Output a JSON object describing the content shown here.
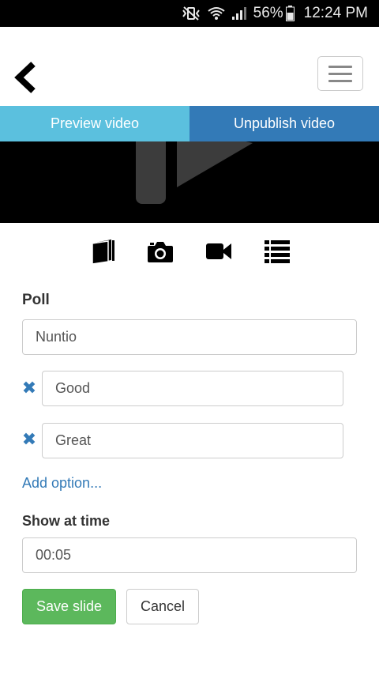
{
  "status_bar": {
    "battery_percent": "56%",
    "time": "12:24 PM",
    "icons": [
      "mute-vibrate-icon",
      "wifi-icon",
      "signal-icon",
      "battery-icon"
    ]
  },
  "nav": {
    "back_icon": "chevron-left-icon",
    "menu_icon": "hamburger-menu-icon"
  },
  "tabs": {
    "preview": "Preview video",
    "unpublish": "Unpublish video",
    "colors": {
      "preview": "#5bc0de",
      "unpublish": "#337ab7"
    }
  },
  "slide_types": [
    "book-icon",
    "camera-icon",
    "video-camera-icon",
    "list-icon"
  ],
  "poll": {
    "heading": "Poll",
    "question_value": "Nuntio",
    "options": [
      {
        "value": "Good"
      },
      {
        "value": "Great"
      }
    ],
    "add_option": "Add option...",
    "show_at_time_label": "Show at time",
    "time_value": "00:05"
  },
  "buttons": {
    "save": "Save slide",
    "cancel": "Cancel",
    "save_color": "#5cb85c"
  }
}
